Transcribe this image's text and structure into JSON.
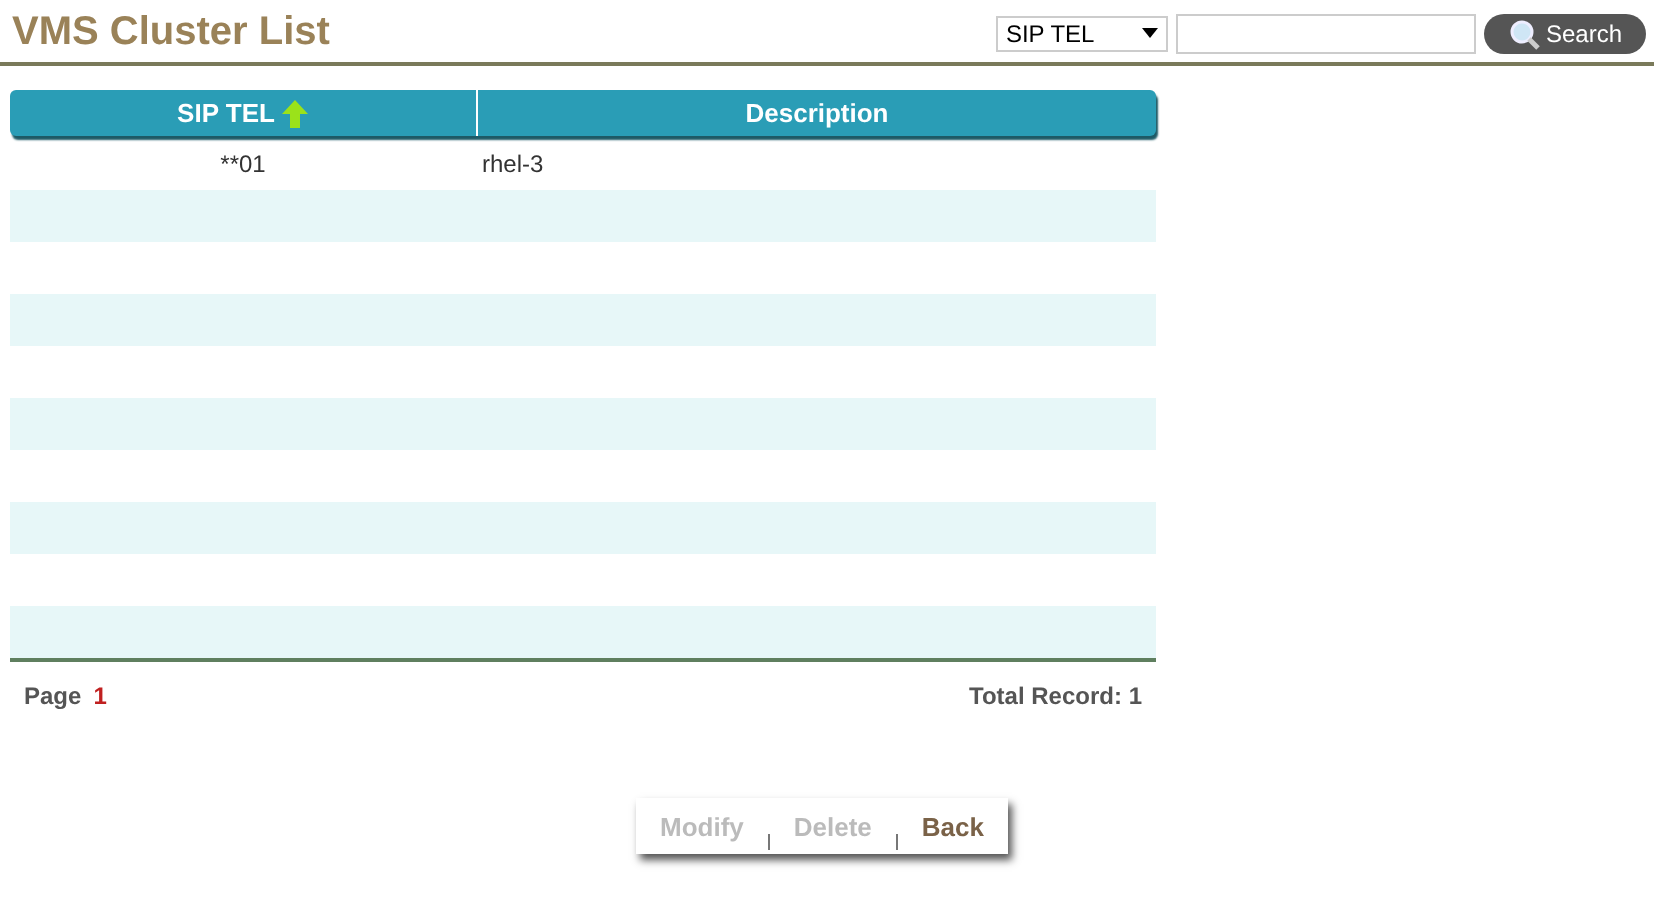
{
  "header": {
    "title": "VMS Cluster List"
  },
  "search": {
    "field_select": "SIP TEL",
    "button": "Search"
  },
  "table": {
    "columns": [
      {
        "label": "SIP TEL",
        "sorted": true
      },
      {
        "label": "Description",
        "sorted": false
      }
    ],
    "rows": [
      {
        "cells": [
          "**01",
          "rhel-3"
        ]
      }
    ]
  },
  "pager": {
    "label": "Page",
    "page": "1",
    "total": "Total Record: 1"
  },
  "buttons": [
    {
      "label": "Modify",
      "disabled": true
    },
    {
      "label": "Delete",
      "disabled": true
    },
    {
      "label": "Back",
      "disabled": false
    }
  ]
}
